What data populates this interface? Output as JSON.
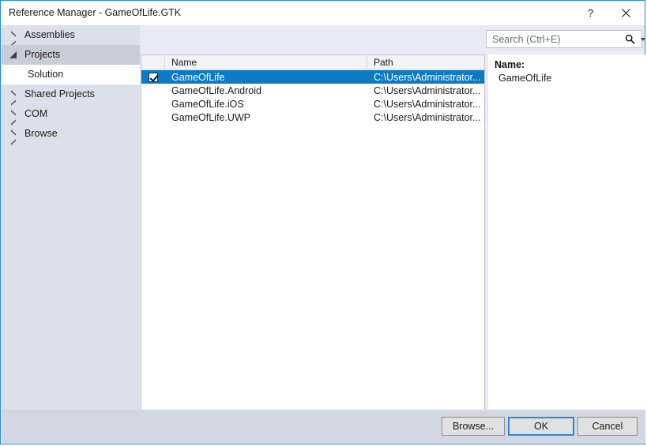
{
  "window": {
    "title": "Reference Manager - GameOfLife.GTK",
    "help_label": "?",
    "help_icon": "question-mark-icon",
    "close_icon": "close-icon"
  },
  "sidebar": {
    "items": [
      {
        "label": "Assemblies",
        "state": "collapsed",
        "level": 0,
        "selected": false
      },
      {
        "label": "Projects",
        "state": "expanded",
        "level": 0,
        "selected": true
      },
      {
        "label": "Solution",
        "state": "leaf",
        "level": 1,
        "selected": false
      },
      {
        "label": "Shared Projects",
        "state": "collapsed",
        "level": 0,
        "selected": false
      },
      {
        "label": "COM",
        "state": "collapsed",
        "level": 0,
        "selected": false
      },
      {
        "label": "Browse",
        "state": "collapsed",
        "level": 0,
        "selected": false
      }
    ]
  },
  "search": {
    "placeholder": "Search (Ctrl+E)",
    "value": "",
    "icon": "magnifier-icon",
    "dropdown_icon": "chevron-down-icon"
  },
  "list": {
    "columns": [
      "",
      "Name",
      "Path"
    ],
    "rows": [
      {
        "checked": true,
        "name": "GameOfLife",
        "path": "C:\\Users\\Administrator...",
        "selected": true
      },
      {
        "checked": false,
        "name": "GameOfLife.Android",
        "path": "C:\\Users\\Administrator...",
        "selected": false
      },
      {
        "checked": false,
        "name": "GameOfLife.iOS",
        "path": "C:\\Users\\Administrator...",
        "selected": false
      },
      {
        "checked": false,
        "name": "GameOfLife.UWP",
        "path": "C:\\Users\\Administrator...",
        "selected": false
      }
    ]
  },
  "details": {
    "name_label": "Name:",
    "name_value": "GameOfLife"
  },
  "footer": {
    "browse_label": "Browse...",
    "ok_label": "OK",
    "cancel_label": "Cancel"
  },
  "colors": {
    "accent": "#0d7ac4",
    "dialog_border": "#2a8ad4",
    "sidebar_bg": "#dce0ea",
    "footer_bg": "#d3d7e3",
    "selected_nav_bg": "#c9cdd7"
  }
}
